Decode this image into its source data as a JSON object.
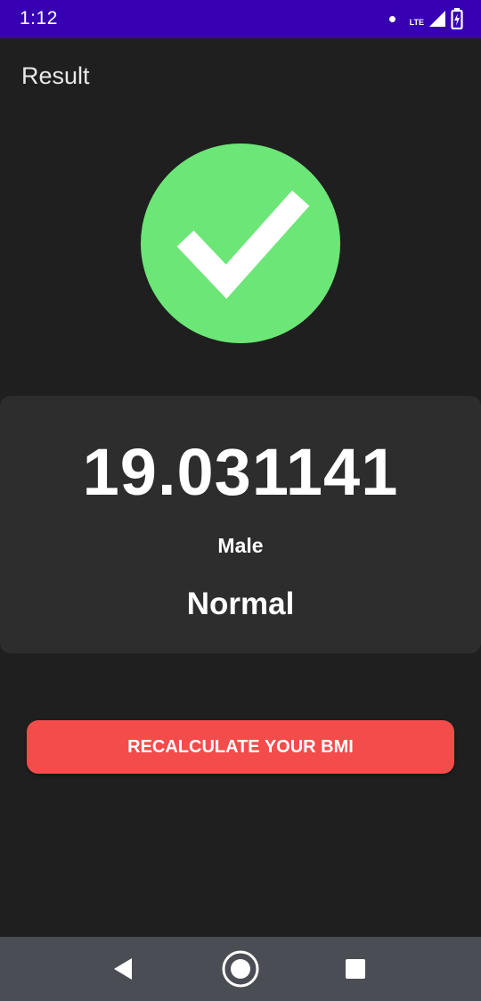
{
  "status_bar": {
    "time": "1:12",
    "network_label": "LTE",
    "icons": [
      "notification-dot-icon",
      "lte-signal-icon",
      "battery-charging-icon"
    ]
  },
  "header": {
    "title": "Result"
  },
  "status_icon": {
    "name": "check-circle-icon",
    "color": "#6ce677"
  },
  "result": {
    "bmi": "19.031141",
    "gender": "Male",
    "category": "Normal"
  },
  "actions": {
    "recalculate_label": "RECALCULATE YOUR BMI",
    "recalculate_color": "#f44b4b"
  },
  "navigation": {
    "buttons": [
      "back-icon",
      "home-icon",
      "recents-icon"
    ]
  },
  "colors": {
    "status_bar": "#3700b3",
    "background": "#1f1f1f",
    "card": "#2d2d2d",
    "nav_bar": "#4a4e54"
  }
}
